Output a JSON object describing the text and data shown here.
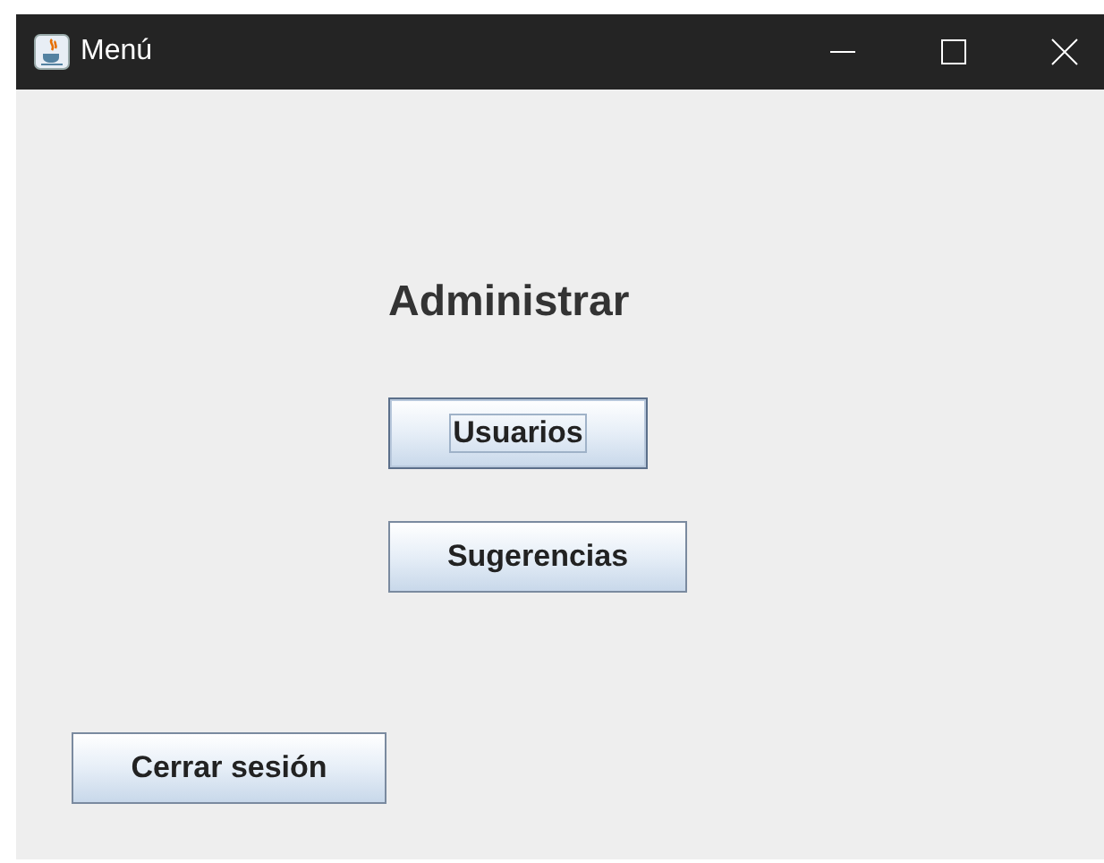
{
  "window": {
    "title": "Menú"
  },
  "heading": "Administrar",
  "buttons": [
    {
      "label": "Usuarios",
      "focused": true
    },
    {
      "label": "Sugerencias",
      "focused": false
    }
  ],
  "logout_button": {
    "label": "Cerrar sesión",
    "focused": false
  }
}
